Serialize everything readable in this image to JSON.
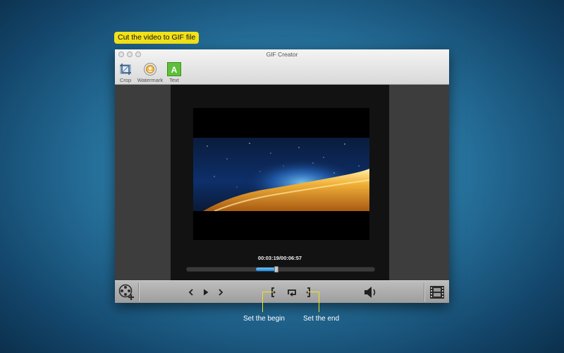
{
  "callout": {
    "text": "Cut the video to GIF file"
  },
  "window": {
    "title": "GIF Creator"
  },
  "toolbar": {
    "items": [
      {
        "label": "Crop",
        "icon": "crop-icon"
      },
      {
        "label": "Watermark",
        "icon": "watermark-icon"
      },
      {
        "label": "Text",
        "icon": "text-icon",
        "glyph": "A"
      }
    ]
  },
  "player": {
    "timecode": "00:03:19/00:06:57",
    "progress": 0.477
  },
  "controls": {
    "add_video": "film-add-icon",
    "previous": "chevron-left-icon",
    "play": "play-icon",
    "next": "chevron-right-icon",
    "set_begin": "bracket-begin-icon",
    "loop": "loop-icon",
    "set_end": "bracket-end-icon",
    "volume": "speaker-icon",
    "filmstrip": "filmstrip-icon"
  },
  "annotations": {
    "set_begin": "Set the begin",
    "set_end": "Set the end"
  },
  "colors": {
    "highlight": "#f3e21a",
    "progress": "#2b8fe0"
  }
}
